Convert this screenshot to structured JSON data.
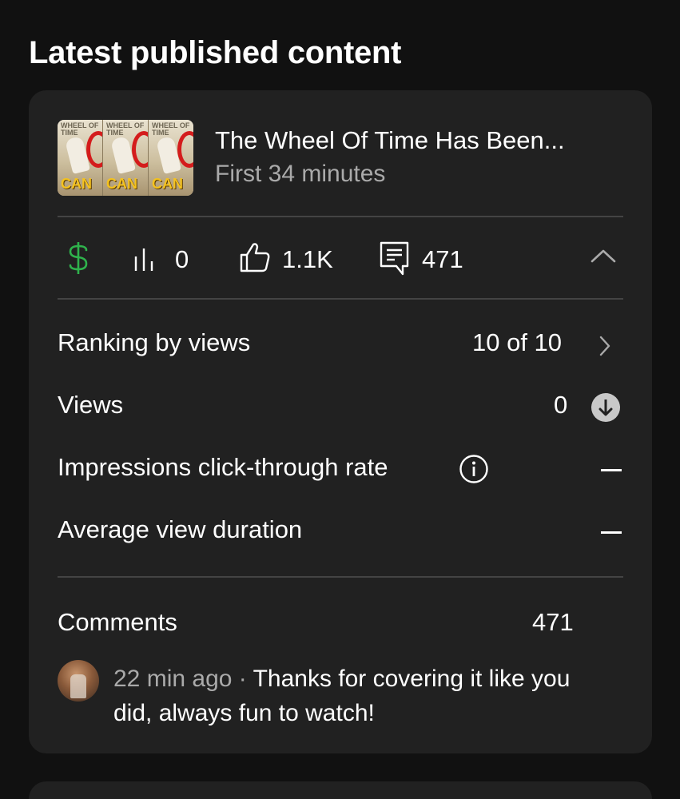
{
  "section": {
    "title": "Latest published content"
  },
  "video": {
    "title": "The Wheel Of Time Has Been...",
    "subtitle": "First 34 minutes",
    "thumbnail": {
      "title_text": "WHEEL OF TIME",
      "overlay_text": "CAN",
      "panels": 3
    }
  },
  "stats": {
    "monetization_icon": "dollar-icon",
    "views_icon": "bar-chart-icon",
    "views": "0",
    "likes_icon": "thumbs-up-icon",
    "likes": "1.1K",
    "comments_icon": "comment-icon",
    "comments": "471",
    "collapse_icon": "chevron-up-icon"
  },
  "metrics": {
    "ranking": {
      "label": "Ranking by views",
      "value": "10 of 10"
    },
    "views": {
      "label": "Views",
      "value": "0",
      "trend": "down"
    },
    "ctr": {
      "label": "Impressions click-through rate",
      "value": "—"
    },
    "avd": {
      "label": "Average view duration",
      "value": "—"
    }
  },
  "comments": {
    "label": "Comments",
    "count": "471",
    "latest": {
      "time": "22 min ago",
      "separator": " · ",
      "text": "Thanks for covering it like you did, always fun to watch!"
    }
  },
  "colors": {
    "background": "#111111",
    "card": "#212121",
    "divider": "#444444",
    "secondary_text": "#aaaaaa",
    "money_green": "#2fb24c"
  }
}
